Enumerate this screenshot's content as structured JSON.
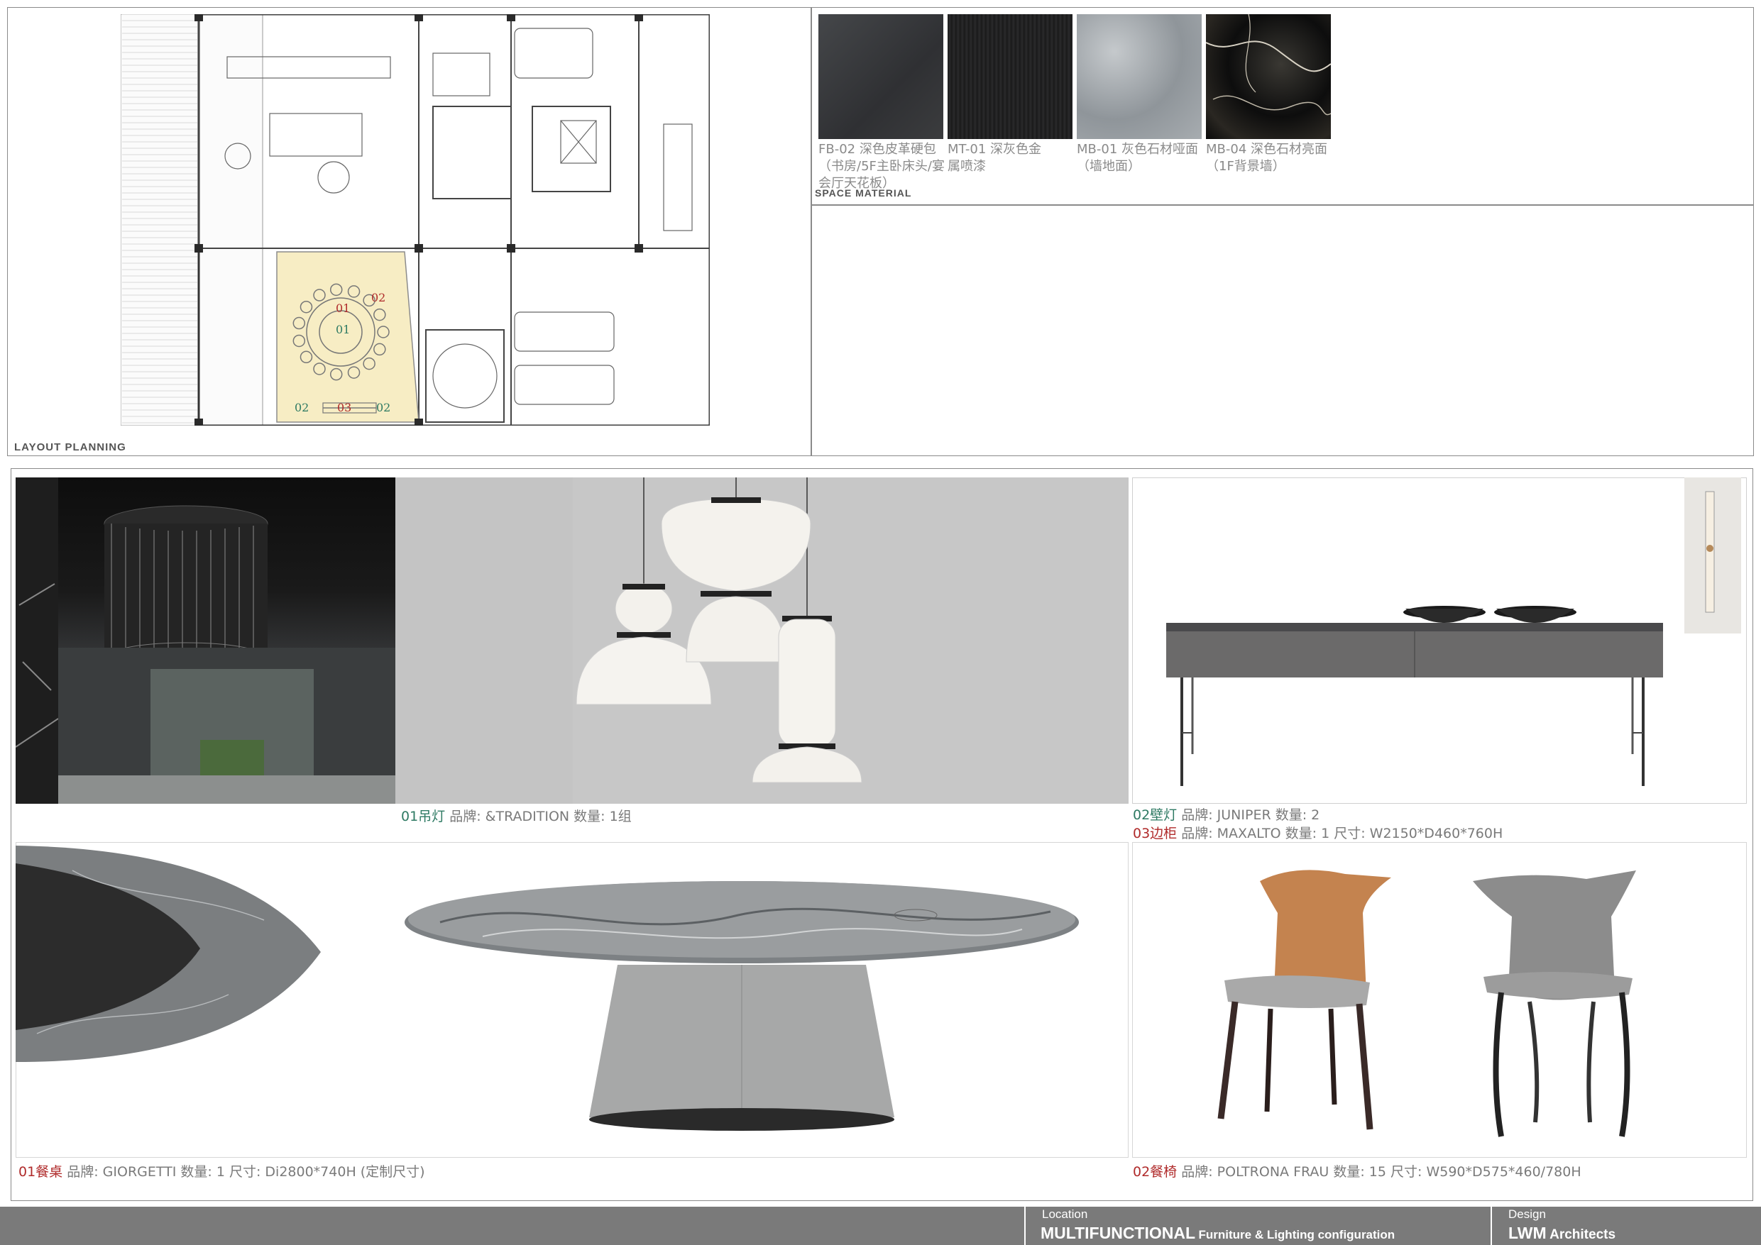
{
  "layout_section": {
    "label": "LAYOUT  PLANNING",
    "plan_marks": {
      "dining_a": "01",
      "dining_b": "01",
      "wall_light_top": "02",
      "bottom_left": "02",
      "bottom_mid": "03",
      "bottom_right": "02"
    }
  },
  "material_section": {
    "label": "SPACE  MATERIAL",
    "swatches": [
      {
        "code_label": "FB-02 深色皮革硬包（书房/5F主卧床头/宴会厅天花板）",
        "color": "#3a3b3d"
      },
      {
        "code_label": "MT-01 深灰色金属喷漆",
        "color": "#1f1f20"
      },
      {
        "code_label": "MB-01 灰色石材哑面（墙地面）",
        "color": "#9fa4a8"
      },
      {
        "code_label": "MB-04 深色石材亮面（1F背景墙）",
        "color": "#141414"
      }
    ]
  },
  "items": {
    "pendant": {
      "tag": "01吊灯",
      "text": "  品牌: &TRADITION  数量: 1组"
    },
    "wall_light": {
      "tag": "02壁灯",
      "text": "  品牌: JUNIPER  数量: 2"
    },
    "sideboard": {
      "tag": "03边柜",
      "text": "  品牌: MAXALTO   数量: 1  尺寸: W2150*D460*760H"
    },
    "table": {
      "tag": "01餐桌",
      "text": "  品牌: GIORGETTI   数量: 1  尺寸: Di2800*740H (定制尺寸)"
    },
    "chair": {
      "tag": "02餐椅",
      "text": "  品牌: POLTRONA FRAU  数量: 15  尺寸: W590*D575*460/780H"
    }
  },
  "footer": {
    "location_label": "Location",
    "project_title": "MULTIFUNCTIONAL",
    "project_subtitle": "Furniture & Lighting configuration",
    "design_label": "Design",
    "firm_name": "LWM",
    "firm_suffix": "Architects"
  },
  "colors": {
    "footer_bg": "#7a7a7a",
    "tag_green": "#2e7a63",
    "tag_red": "#b02b2b",
    "plan_highlight": "#f7edc4"
  }
}
